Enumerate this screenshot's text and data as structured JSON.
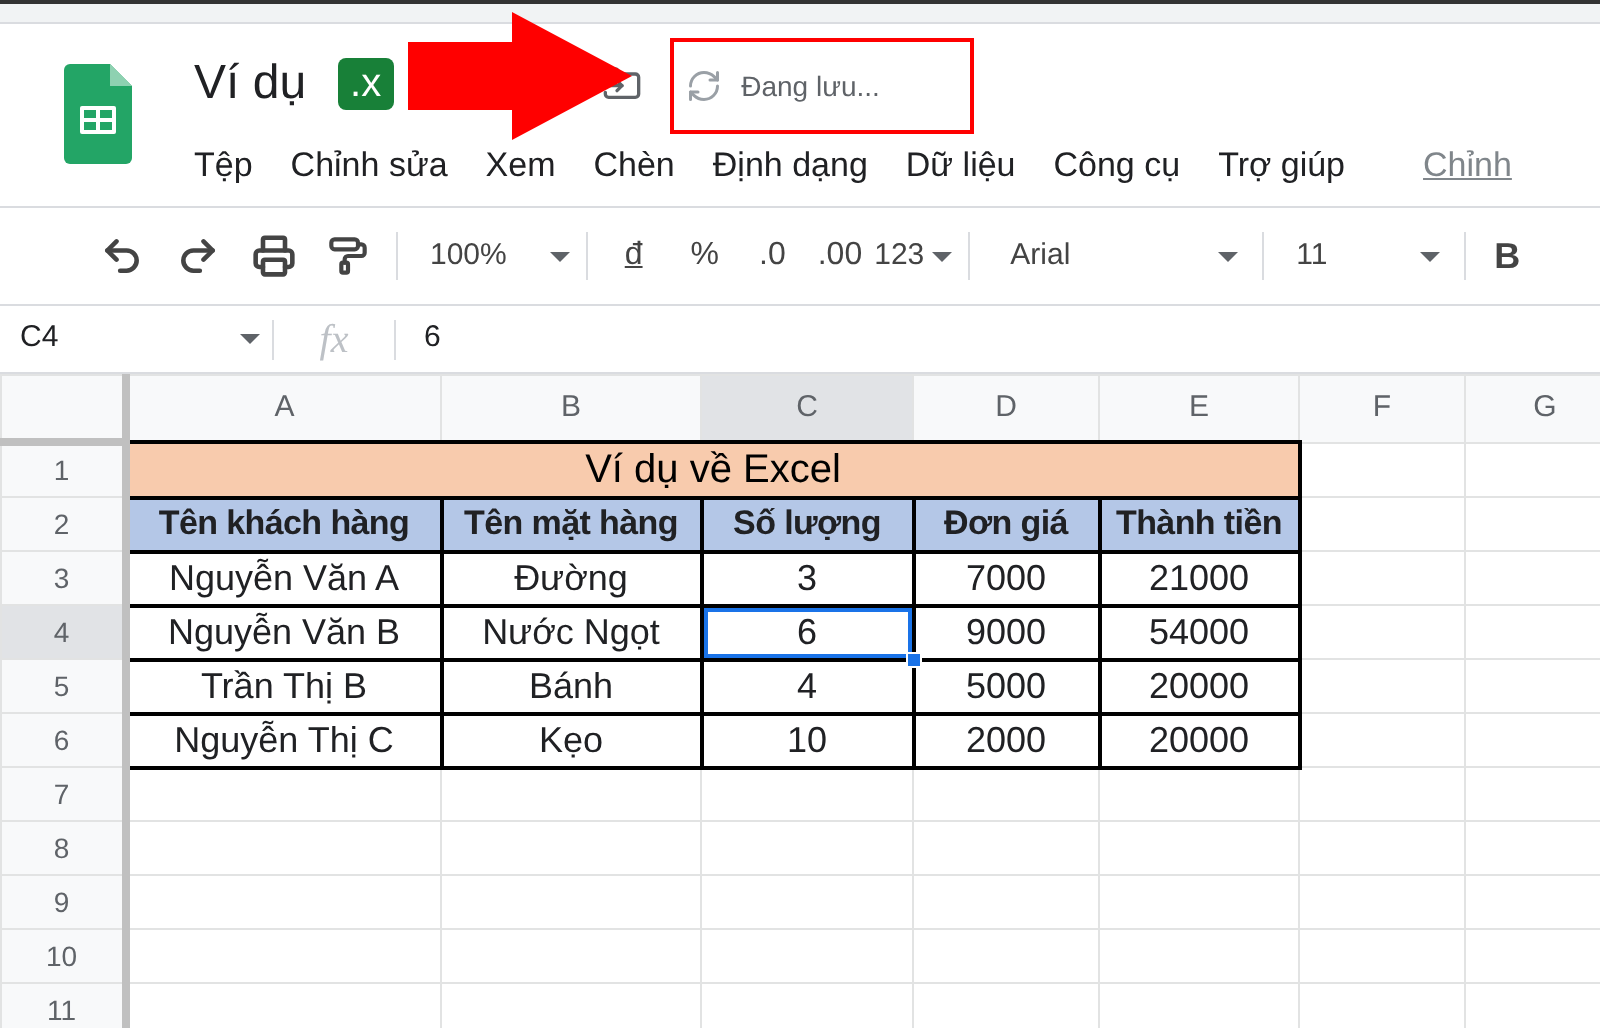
{
  "document": {
    "title": "Ví dụ",
    "format_badge": ".x",
    "save_status": "Đang lưu..."
  },
  "menu": [
    {
      "label": "Tệp",
      "kind": "menu"
    },
    {
      "label": "Chỉnh sửa",
      "kind": "menu"
    },
    {
      "label": "Xem",
      "kind": "menu"
    },
    {
      "label": "Chèn",
      "kind": "menu"
    },
    {
      "label": "Định dạng",
      "kind": "menu"
    },
    {
      "label": "Dữ liệu",
      "kind": "menu"
    },
    {
      "label": "Công cụ",
      "kind": "menu"
    },
    {
      "label": "Trợ giúp",
      "kind": "menu"
    },
    {
      "label": "Chỉnh",
      "kind": "link"
    }
  ],
  "toolbar": {
    "zoom": "100%",
    "currency": "đ",
    "percent": "%",
    "decrease_decimals": ".0",
    "increase_decimals": ".00",
    "number_format": "123",
    "font": "Arial",
    "font_size": "11",
    "bold": "B"
  },
  "formula_bar": {
    "cell_ref": "C4",
    "fx": "fx",
    "value": "6"
  },
  "sheet": {
    "columns": [
      {
        "label": "A",
        "selected": false
      },
      {
        "label": "B",
        "selected": false
      },
      {
        "label": "C",
        "selected": true
      },
      {
        "label": "D",
        "selected": false
      },
      {
        "label": "E",
        "selected": false
      },
      {
        "label": "F",
        "selected": false
      },
      {
        "label": "G",
        "selected": false
      }
    ],
    "rows": [
      {
        "label": "1",
        "selected": false,
        "kind": "title",
        "text": "Ví dụ về Excel"
      },
      {
        "label": "2",
        "selected": false,
        "kind": "header",
        "cells": [
          "Tên khách hàng",
          "Tên mặt hàng",
          "Số lượng",
          "Đơn giá",
          "Thành tiền"
        ]
      },
      {
        "label": "3",
        "selected": false,
        "kind": "data",
        "cells": [
          {
            "text": "Nguyễn Văn A",
            "selected": false
          },
          {
            "text": "Đường",
            "selected": false
          },
          {
            "text": "3",
            "selected": false
          },
          {
            "text": "7000",
            "selected": false
          },
          {
            "text": "21000",
            "selected": false
          }
        ]
      },
      {
        "label": "4",
        "selected": true,
        "kind": "data",
        "cells": [
          {
            "text": "Nguyễn Văn B",
            "selected": false
          },
          {
            "text": "Nước Ngọt",
            "selected": false
          },
          {
            "text": "6",
            "selected": true
          },
          {
            "text": "9000",
            "selected": false
          },
          {
            "text": "54000",
            "selected": false
          }
        ]
      },
      {
        "label": "5",
        "selected": false,
        "kind": "data",
        "cells": [
          {
            "text": "Trần Thị B",
            "selected": false
          },
          {
            "text": "Bánh",
            "selected": false
          },
          {
            "text": "4",
            "selected": false
          },
          {
            "text": "5000",
            "selected": false
          },
          {
            "text": "20000",
            "selected": false
          }
        ]
      },
      {
        "label": "6",
        "selected": false,
        "kind": "data",
        "cells": [
          {
            "text": "Nguyễn Thị C",
            "selected": false
          },
          {
            "text": "Kẹo",
            "selected": false
          },
          {
            "text": "10",
            "selected": false
          },
          {
            "text": "2000",
            "selected": false
          },
          {
            "text": "20000",
            "selected": false
          }
        ]
      },
      {
        "label": "7",
        "selected": false,
        "kind": "empty"
      },
      {
        "label": "8",
        "selected": false,
        "kind": "empty"
      },
      {
        "label": "9",
        "selected": false,
        "kind": "empty"
      },
      {
        "label": "10",
        "selected": false,
        "kind": "empty"
      },
      {
        "label": "11",
        "selected": false,
        "kind": "empty"
      }
    ]
  }
}
